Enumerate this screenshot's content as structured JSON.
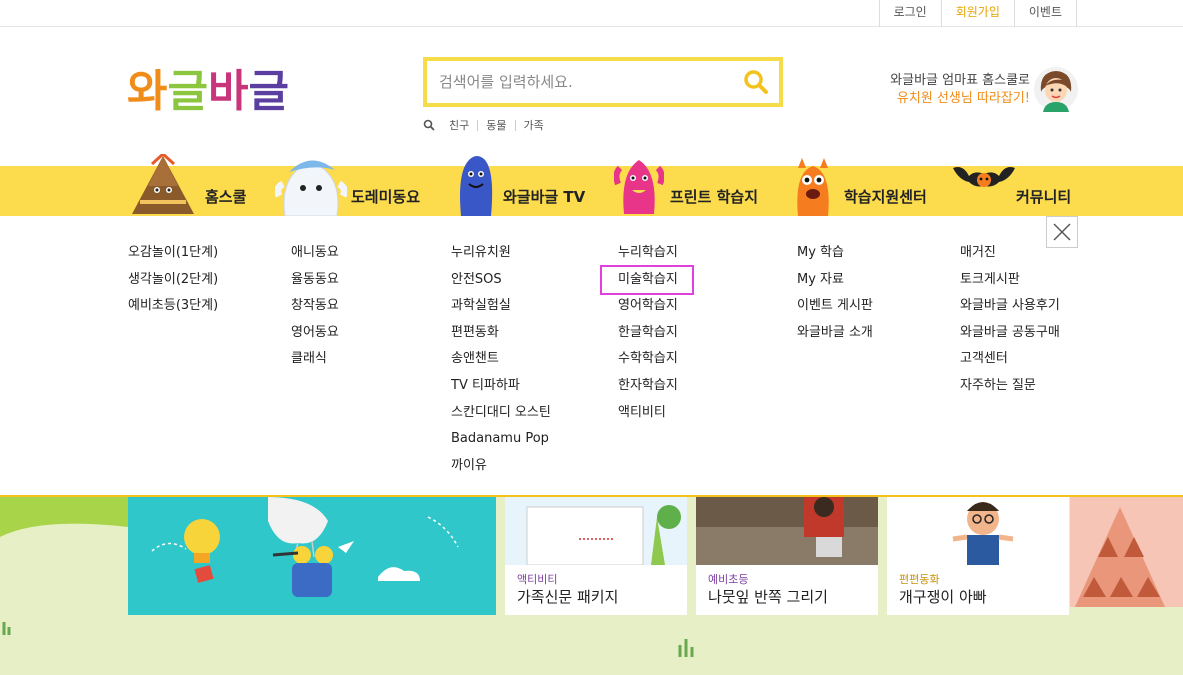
{
  "topbar": {
    "items": [
      "로그인",
      "회원가입",
      "이벤트"
    ]
  },
  "logo": {
    "text": "와글바글"
  },
  "search": {
    "placeholder": "검색어를 입력하세요.",
    "keywords": [
      "친구",
      "동물",
      "가족"
    ]
  },
  "promo": {
    "line1": "와글바글 엄마표 홈스쿨로",
    "line2": "유치원 선생님 따라잡기!"
  },
  "gnb": [
    "홈스쿨",
    "도레미동요",
    "와글바글 TV",
    "프린트 학습지",
    "학습지원센터",
    "커뮤니티"
  ],
  "menu": [
    [
      "오감놀이(1단계)",
      "생각놀이(2단계)",
      "예비초등(3단계)"
    ],
    [
      "애니동요",
      "율동동요",
      "창작동요",
      "영어동요",
      "클래식"
    ],
    [
      "누리유치원",
      "안전SOS",
      "과학실험실",
      "편편동화",
      "송앤챈트",
      "TV 티파하파",
      "스칸디대디 오스틴",
      "Badanamu Pop",
      "까이유"
    ],
    [
      "누리학습지",
      "미술학습지",
      "영어학습지",
      "한글학습지",
      "수학학습지",
      "한자학습지",
      "액티비티"
    ],
    [
      "My 학습",
      "My 자료",
      "이벤트 게시판",
      "와글바글 소개"
    ],
    [
      "매거진",
      "토크게시판",
      "와글바글 사용후기",
      "와글바글 공동구매",
      "고객센터",
      "자주하는 질문"
    ]
  ],
  "cards": [
    {
      "category": "액티비티",
      "title": "가족신문 패키지",
      "category_color": "#7b3fa0"
    },
    {
      "category": "예비초등",
      "title": "나뭇잎 반쪽 그리기",
      "category_color": "#7b3fa0"
    },
    {
      "category": "편편동화",
      "title": "개구쟁이 아빠",
      "category_color": "#c8920a"
    }
  ],
  "colors": {
    "accent_yellow": "#fcdc4d",
    "search_border": "#f7dc4a",
    "promo_orange": "#f08c1a",
    "selected_outline": "#e040e0"
  }
}
